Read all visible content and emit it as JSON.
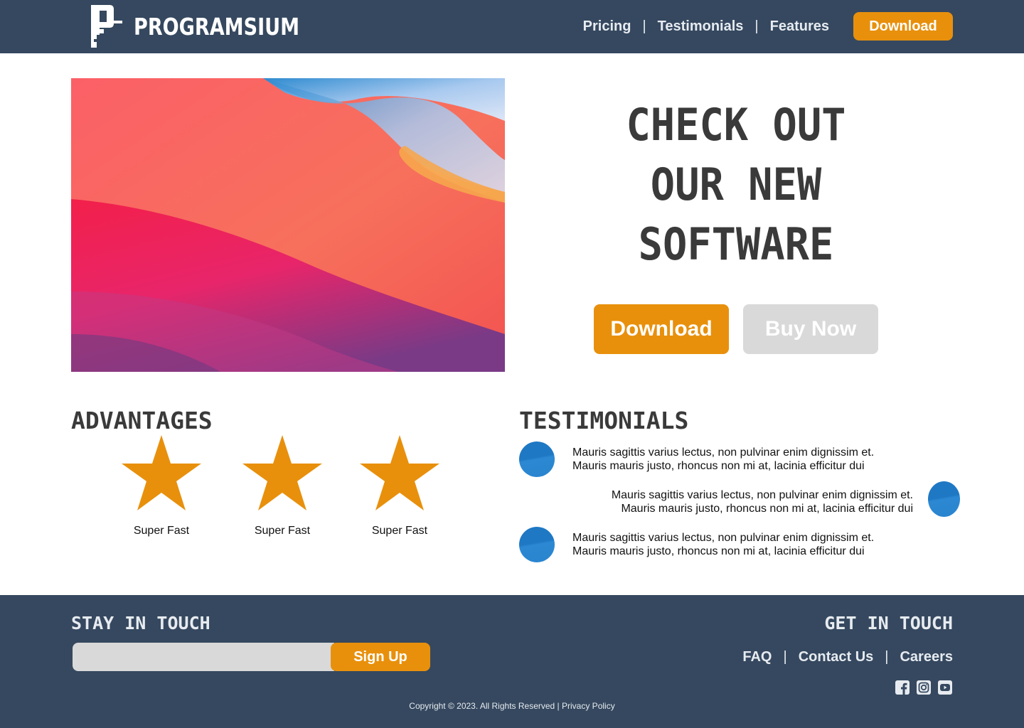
{
  "header": {
    "brand": "PROGRAMSIUM",
    "nav": [
      "Pricing",
      "Testimonials",
      "Features"
    ],
    "download_label": "Download"
  },
  "hero": {
    "title_lines": [
      "CHECK OUT",
      "OUR NEW",
      "SOFTWARE"
    ],
    "download_label": "Download",
    "buy_label": "Buy Now"
  },
  "advantages": {
    "heading": "ADVANTAGES",
    "items": [
      {
        "icon": "star-icon",
        "label": "Super Fast"
      },
      {
        "icon": "star-icon",
        "label": "Super Fast"
      },
      {
        "icon": "star-icon",
        "label": "Super Fast"
      }
    ]
  },
  "testimonials": {
    "heading": "TESTIMONIALS",
    "items": [
      {
        "line1": "Mauris sagittis varius lectus, non pulvinar enim dignissim et.",
        "line2": "Mauris mauris justo, rhoncus non mi at, lacinia efficitur dui",
        "align": "left"
      },
      {
        "line1": "Mauris sagittis varius lectus, non pulvinar enim dignissim et.",
        "line2": "Mauris mauris justo, rhoncus non mi at, lacinia efficitur dui",
        "align": "right"
      },
      {
        "line1": "Mauris sagittis varius lectus, non pulvinar enim dignissim et.",
        "line2": "Mauris mauris justo, rhoncus non mi at, lacinia efficitur dui",
        "align": "left"
      }
    ]
  },
  "footer": {
    "stay_heading": "STAY IN TOUCH",
    "email_placeholder": "",
    "signup_label": "Sign Up",
    "get_heading": "GET IN TOUCH",
    "links": [
      "FAQ",
      "Contact Us",
      "Careers"
    ],
    "social": [
      "facebook-icon",
      "instagram-icon",
      "youtube-icon"
    ],
    "copyright": "Copyright © 2023. All Rights Reserved | Privacy Policy"
  },
  "colors": {
    "navy": "#35485f",
    "accent": "#e8900c",
    "disabled": "#d9d9d9",
    "heading_text": "#3a3a3a"
  }
}
